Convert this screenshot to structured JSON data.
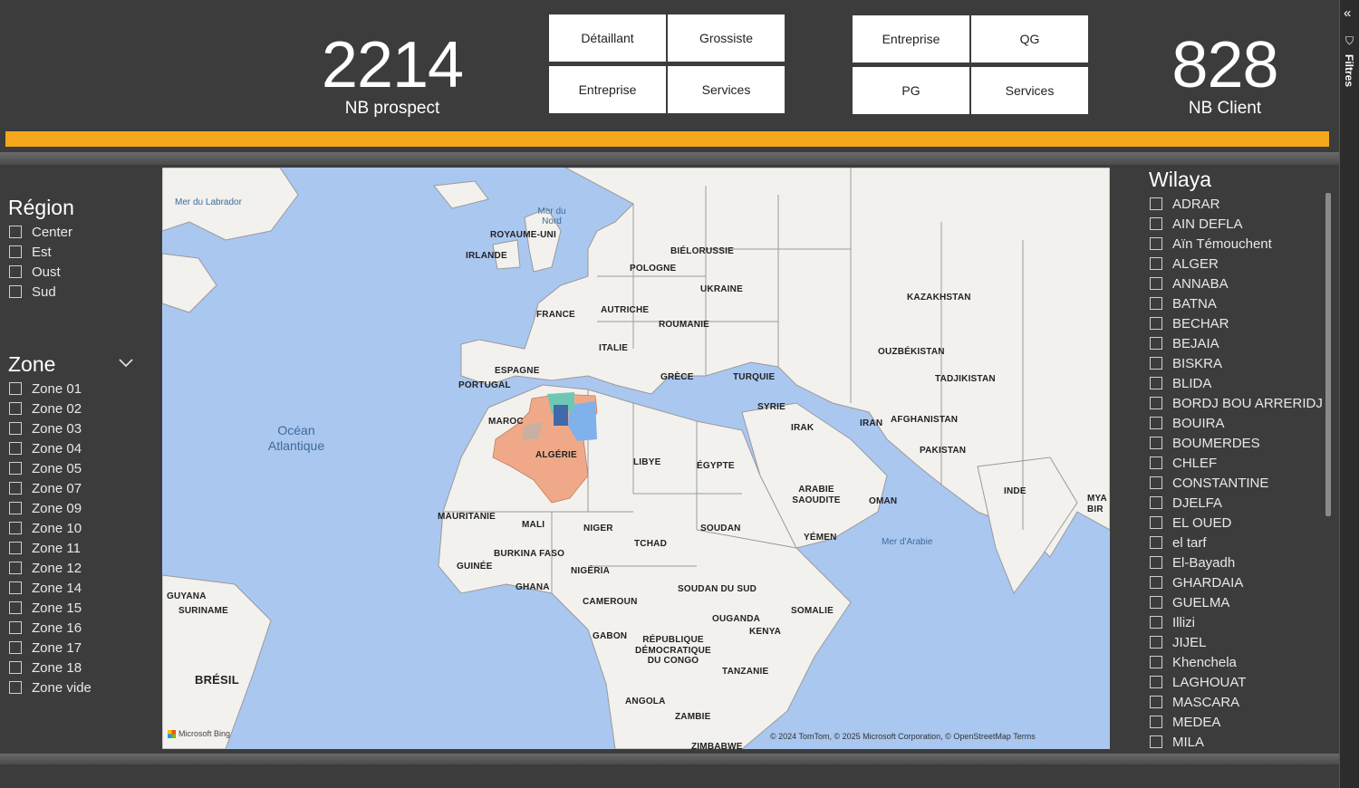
{
  "kpis": {
    "prospect": {
      "value": "2214",
      "label": "NB prospect"
    },
    "client": {
      "value": "828",
      "label": "NB Client"
    }
  },
  "button_group_1": [
    "Détaillant",
    "Grossiste",
    "Entreprise",
    "Services"
  ],
  "button_group_2": [
    "Entreprise",
    "QG",
    "PG",
    "Services"
  ],
  "right_rail": {
    "label": "Filtres",
    "collapse_icon": "double-chevron-left-icon",
    "filter_icon": "funnel-icon"
  },
  "region": {
    "title": "Région",
    "items": [
      "Center",
      "Est",
      "Oust",
      "Sud"
    ]
  },
  "zone": {
    "title": "Zone",
    "items": [
      "Zone 01",
      "Zone 02",
      "Zone 03",
      "Zone 04",
      "Zone 05",
      "Zone 07",
      "Zone 09",
      "Zone 10",
      "Zone 11",
      "Zone 12",
      "Zone 14",
      "Zone 15",
      "Zone 16",
      "Zone 17",
      "Zone 18",
      "Zone vide"
    ]
  },
  "wilaya": {
    "title": "Wilaya",
    "items": [
      "ADRAR",
      "AIN DEFLA",
      "Aïn Témouchent",
      "ALGER",
      "ANNABA",
      "BATNA",
      "BECHAR",
      "BEJAIA",
      "BISKRA",
      "BLIDA",
      "BORDJ BOU ARRERIDJ",
      "BOUIRA",
      "BOUMERDES",
      "CHLEF",
      "CONSTANTINE",
      "DJELFA",
      "EL OUED",
      "el tarf",
      "El-Bayadh",
      "GHARDAIA",
      "GUELMA",
      "Illizi",
      "JIJEL",
      "Khenchela",
      "LAGHOUAT",
      "MASCARA",
      "MEDEA",
      "MILA"
    ]
  },
  "map": {
    "countries": [
      "ROYAUME-UNI",
      "IRLANDE",
      "BIÉLORUSSIE",
      "POLOGNE",
      "UKRAINE",
      "KAZAKHSTAN",
      "FRANCE",
      "AUTRICHE",
      "ROUMANIE",
      "ITALIE",
      "OUZBÉKISTAN",
      "ESPAGNE",
      "PORTUGAL",
      "GRÈCE",
      "TURQUIE",
      "TADJIKISTAN",
      "SYRIE",
      "MAROC",
      "IRAK",
      "IRAN",
      "AFGHANISTAN",
      "ALGÉRIE",
      "PAKISTAN",
      "LIBYE",
      "ÉGYPTE",
      "ARABIE SAOUDITE",
      "OMAN",
      "INDE",
      "MAURITANIE",
      "MALI",
      "NIGER",
      "SOUDAN",
      "YÉMEN",
      "TCHAD",
      "BURKINA FASO",
      "GUINÉE",
      "NIGÉRIA",
      "GHANA",
      "SOUDAN DU SUD",
      "CAMEROUN",
      "SOMALIE",
      "GUYANA",
      "SURINAME",
      "OUGANDA",
      "KENYA",
      "GABON",
      "RÉPUBLIQUE DÉMOCRATIQUE DU CONGO",
      "TANZANIE",
      "BRÉSIL",
      "ANGOLA",
      "ZAMBIE",
      "ZIMBABWE",
      "MYA BIR"
    ],
    "waters": [
      "Mer du Labrador",
      "Mer du Nord",
      "Océan Atlantique",
      "Mer d'Arabie"
    ],
    "bing": "Microsoft Bing",
    "attribution": "© 2024 TomTom, © 2025 Microsoft Corporation, © OpenStreetMap Terms"
  },
  "colors": {
    "background": "#3c3c3c",
    "accent_bar": "#f5a81c",
    "water": "#aac7f0",
    "land": "#f2f1ee",
    "highlight_main": "#f0a988",
    "highlight_blue": "#7fb2ea",
    "highlight_teal": "#6fc7b3"
  }
}
